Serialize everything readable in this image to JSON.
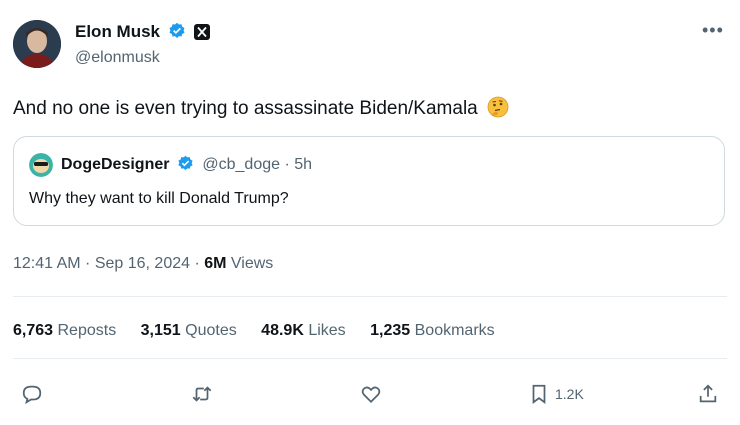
{
  "author": {
    "name": "Elon Musk",
    "handle": "@elonmusk",
    "verified_color": "#1d9bf0"
  },
  "more_label": "•••",
  "tweet": {
    "text": "And no one is even trying to assassinate Biden/Kamala",
    "emoji_icon": "thinking-face-emoji"
  },
  "quote": {
    "name": "DogeDesigner",
    "meta": "@cb_doge · 5h",
    "text": "Why they want to kill Donald Trump?"
  },
  "meta": {
    "time": "12:41 AM · Sep 16, 2024 · ",
    "views_count": "6M",
    "views_label": " Views"
  },
  "stats": {
    "reposts_count": "6,763",
    "reposts_label": " Reposts",
    "quotes_count": "3,151",
    "quotes_label": " Quotes",
    "likes_count": "48.9K",
    "likes_label": " Likes",
    "bookmarks_count": "1,235",
    "bookmarks_label": " Bookmarks"
  },
  "actions": {
    "reply_icon": "reply-icon",
    "repost_icon": "repost-icon",
    "like_icon": "heart-icon",
    "bookmark_icon": "bookmark-icon",
    "bookmark_count": "1.2K",
    "share_icon": "share-icon"
  }
}
